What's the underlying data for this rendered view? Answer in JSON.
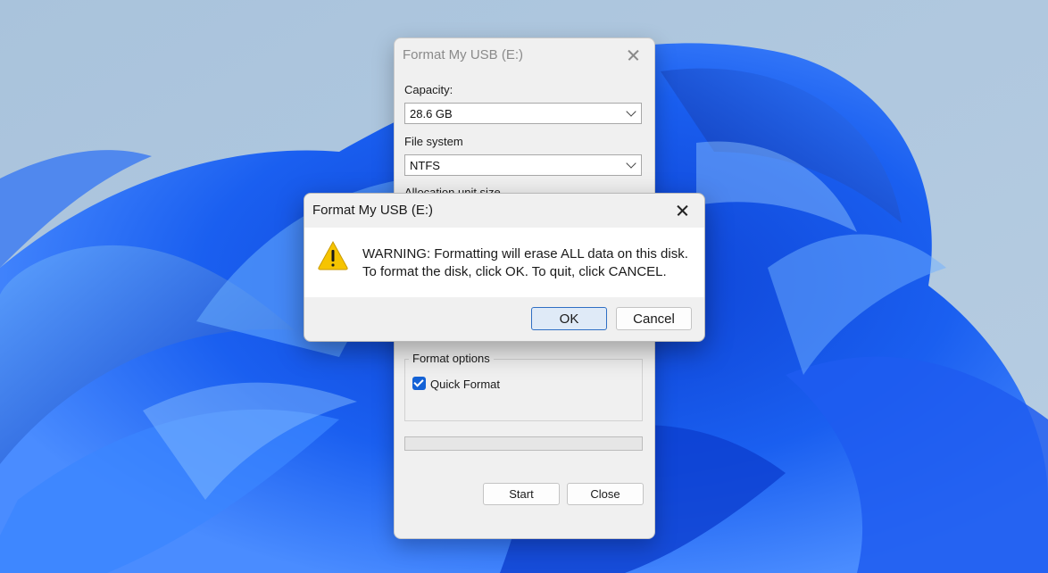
{
  "format_dialog": {
    "title": "Format My USB (E:)",
    "capacity_label": "Capacity:",
    "capacity_value": "28.6 GB",
    "filesystem_label": "File system",
    "filesystem_value": "NTFS",
    "allocation_label": "Allocation unit size",
    "format_options_label": "Format options",
    "quick_format_label": "Quick Format",
    "quick_format_checked": true,
    "progress_fraction": 0,
    "start_label": "Start",
    "close_label": "Close"
  },
  "warning_dialog": {
    "title": "Format My USB (E:)",
    "message_line1": "WARNING: Formatting will erase ALL data on this disk.",
    "message_line2": "To format the disk, click OK. To quit, click CANCEL.",
    "icon": "warning-icon",
    "ok_label": "OK",
    "cancel_label": "Cancel"
  },
  "colors": {
    "accent": "#1462d6",
    "warning_yellow": "#f6c400"
  }
}
